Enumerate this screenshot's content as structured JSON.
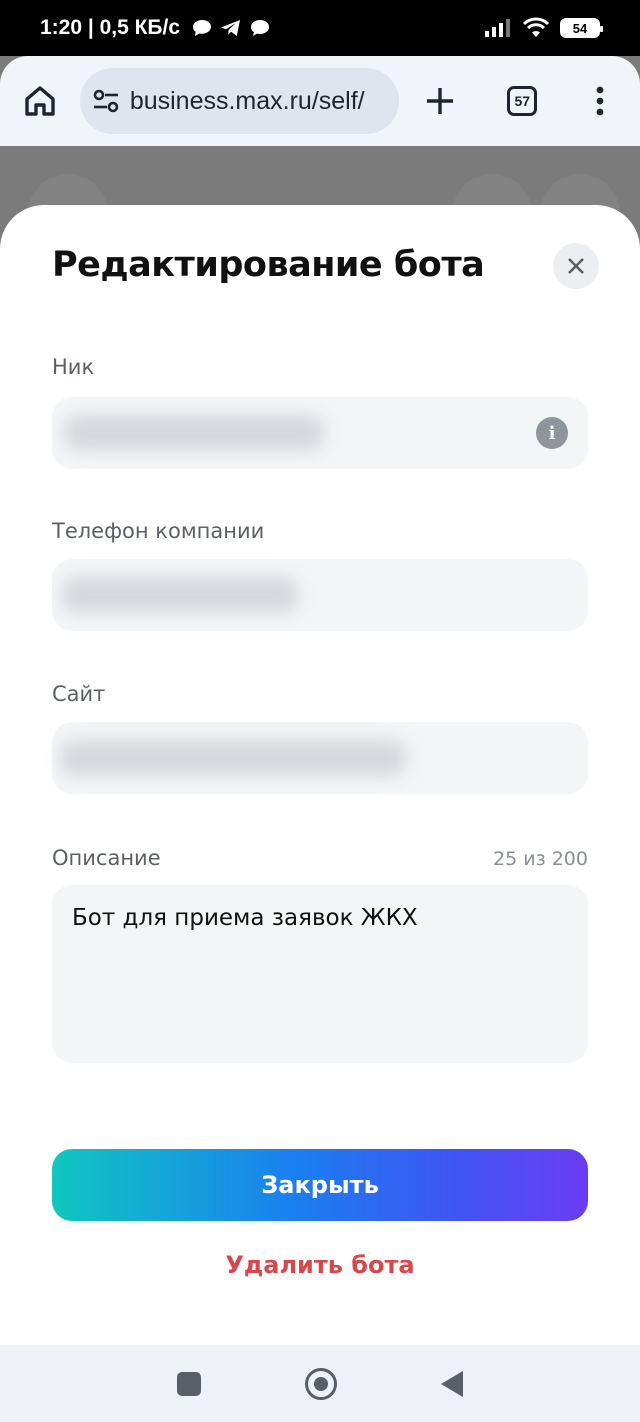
{
  "status_bar": {
    "time_and_speed": "1:20 | 0,5 КБ/с",
    "battery": "54"
  },
  "browser": {
    "url": "business.max.ru/self/",
    "tabs_count": "57"
  },
  "modal": {
    "title": "Редактирование бота",
    "fields": {
      "nick": {
        "label": "Ник"
      },
      "phone": {
        "label": "Телефон компании"
      },
      "site": {
        "label": "Сайт"
      },
      "description": {
        "label": "Описание",
        "counter": "25 из 200",
        "value": "Бот для приема заявок ЖКХ"
      }
    },
    "close_button": "Закрыть",
    "delete_link": "Удалить бота"
  },
  "colors": {
    "danger": "#d9474b",
    "gradient_start": "#10c7c0",
    "gradient_end": "#6b3cf5"
  }
}
